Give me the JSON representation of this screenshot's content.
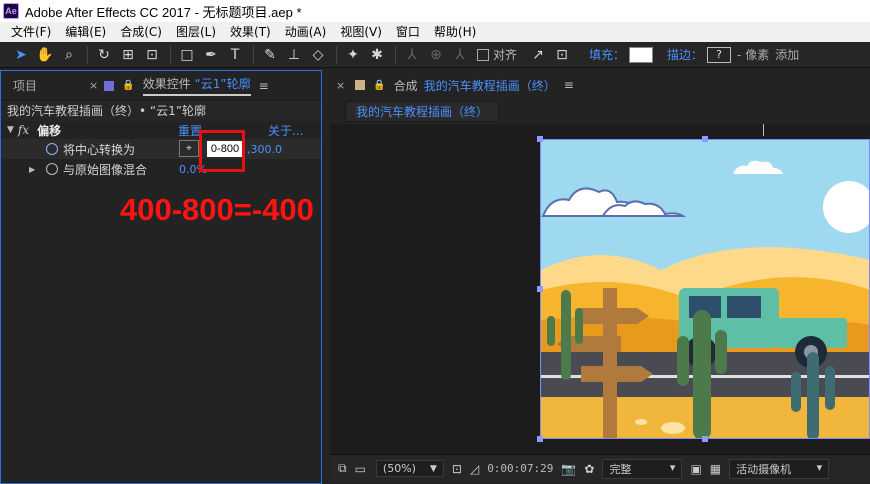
{
  "window": {
    "app_icon": "Ae",
    "title": "Adobe After Effects CC 2017 - 无标题项目.aep *"
  },
  "menu": [
    "文件(F)",
    "编辑(E)",
    "合成(C)",
    "图层(L)",
    "效果(T)",
    "动画(A)",
    "视图(V)",
    "窗口",
    "帮助(H)"
  ],
  "toolbar": {
    "snap_label": "对齐",
    "fill_label": "填充：",
    "stroke_label": "描边：",
    "stroke_value": "?",
    "stroke_px": "- 像素",
    "add_label": "添加"
  },
  "left_panel": {
    "tab_project": "项目",
    "tab_effects_prefix": "效果控件",
    "tab_effects_layer": "“云1”轮廓",
    "breadcrumb": "我的汽车教程插画（终）• “云1”轮廓",
    "effect": {
      "name": "偏移",
      "reset": "重置",
      "about": "关于..."
    },
    "props": [
      {
        "label": "将中心转换为",
        "x_value": "0-800",
        "y_value": ",300.0"
      },
      {
        "label": "与原始图像混合",
        "value": "0.0%"
      }
    ],
    "annotation": "400-800=-400"
  },
  "comp_panel": {
    "tab_label": "合成",
    "comp_name": "我的汽车教程插画（终）",
    "chip": "我的汽车教程插画（终）",
    "footer": {
      "zoom": "(50%)",
      "timecode": "0:00:07:29",
      "quality": "完整",
      "camera": "活动摄像机"
    }
  },
  "colors": {
    "accent_blue": "#4a90ff",
    "annotation_red": "#ff1414",
    "sky": "#9ed9f0",
    "desert": "#f6b52c",
    "car": "#5fbfa6"
  }
}
